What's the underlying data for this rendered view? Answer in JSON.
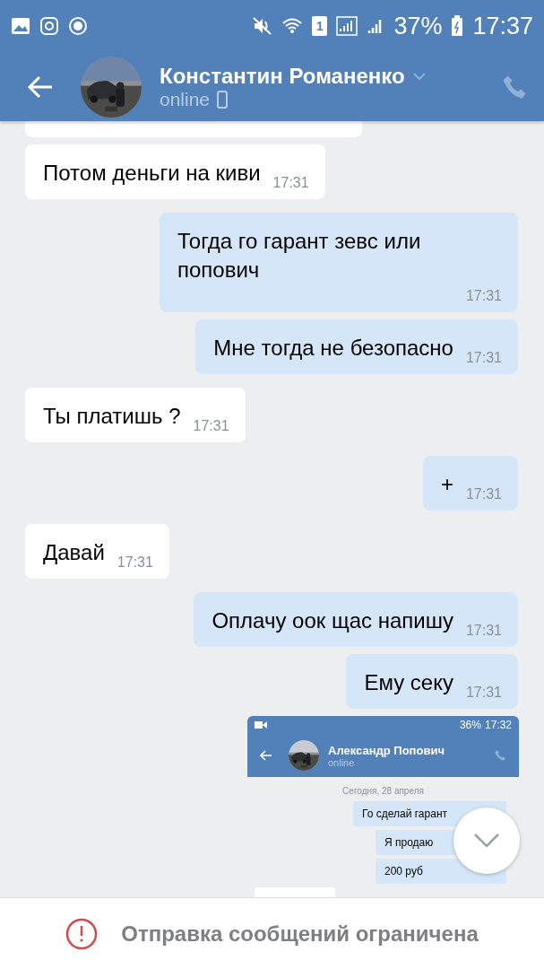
{
  "status_bar": {
    "sim": "1",
    "battery": "37%",
    "time": "17:37"
  },
  "header": {
    "name": "Константин Романенко",
    "status": "online"
  },
  "messages": [
    {
      "kind": "partial",
      "outgoing": false
    },
    {
      "kind": "text",
      "outgoing": false,
      "text": "Потом деньги на киви",
      "time": "17:31"
    },
    {
      "kind": "text",
      "outgoing": true,
      "text": "Тогда го гарант зевс или попович",
      "time": "17:31"
    },
    {
      "kind": "text",
      "outgoing": true,
      "text": "Мне тогда не безопасно",
      "time": "17:31"
    },
    {
      "kind": "text",
      "outgoing": false,
      "text": "Ты платишь ?",
      "time": "17:31"
    },
    {
      "kind": "text",
      "outgoing": true,
      "text": "+",
      "time": "17:31"
    },
    {
      "kind": "text",
      "outgoing": false,
      "text": "Давай",
      "time": "17:31"
    },
    {
      "kind": "text",
      "outgoing": true,
      "text": "Оплачу оок щас напишу",
      "time": "17:31"
    },
    {
      "kind": "text",
      "outgoing": true,
      "text": "Ему секу",
      "time": "17:31"
    },
    {
      "kind": "screenshot",
      "outgoing": true,
      "screenshot": {
        "battery": "36%",
        "time": "17:32",
        "name": "Александр Попович",
        "status": "online",
        "date": "Сегодня, 28 апреля",
        "messages": [
          {
            "outgoing": true,
            "text": "Го сделай гарант"
          },
          {
            "outgoing": true,
            "text": "Я продаю"
          },
          {
            "outgoing": true,
            "text": "200 руб"
          },
          {
            "outgoing": false
          }
        ]
      }
    }
  ],
  "footer": {
    "notice": "Отправка сообщений ограничена"
  }
}
